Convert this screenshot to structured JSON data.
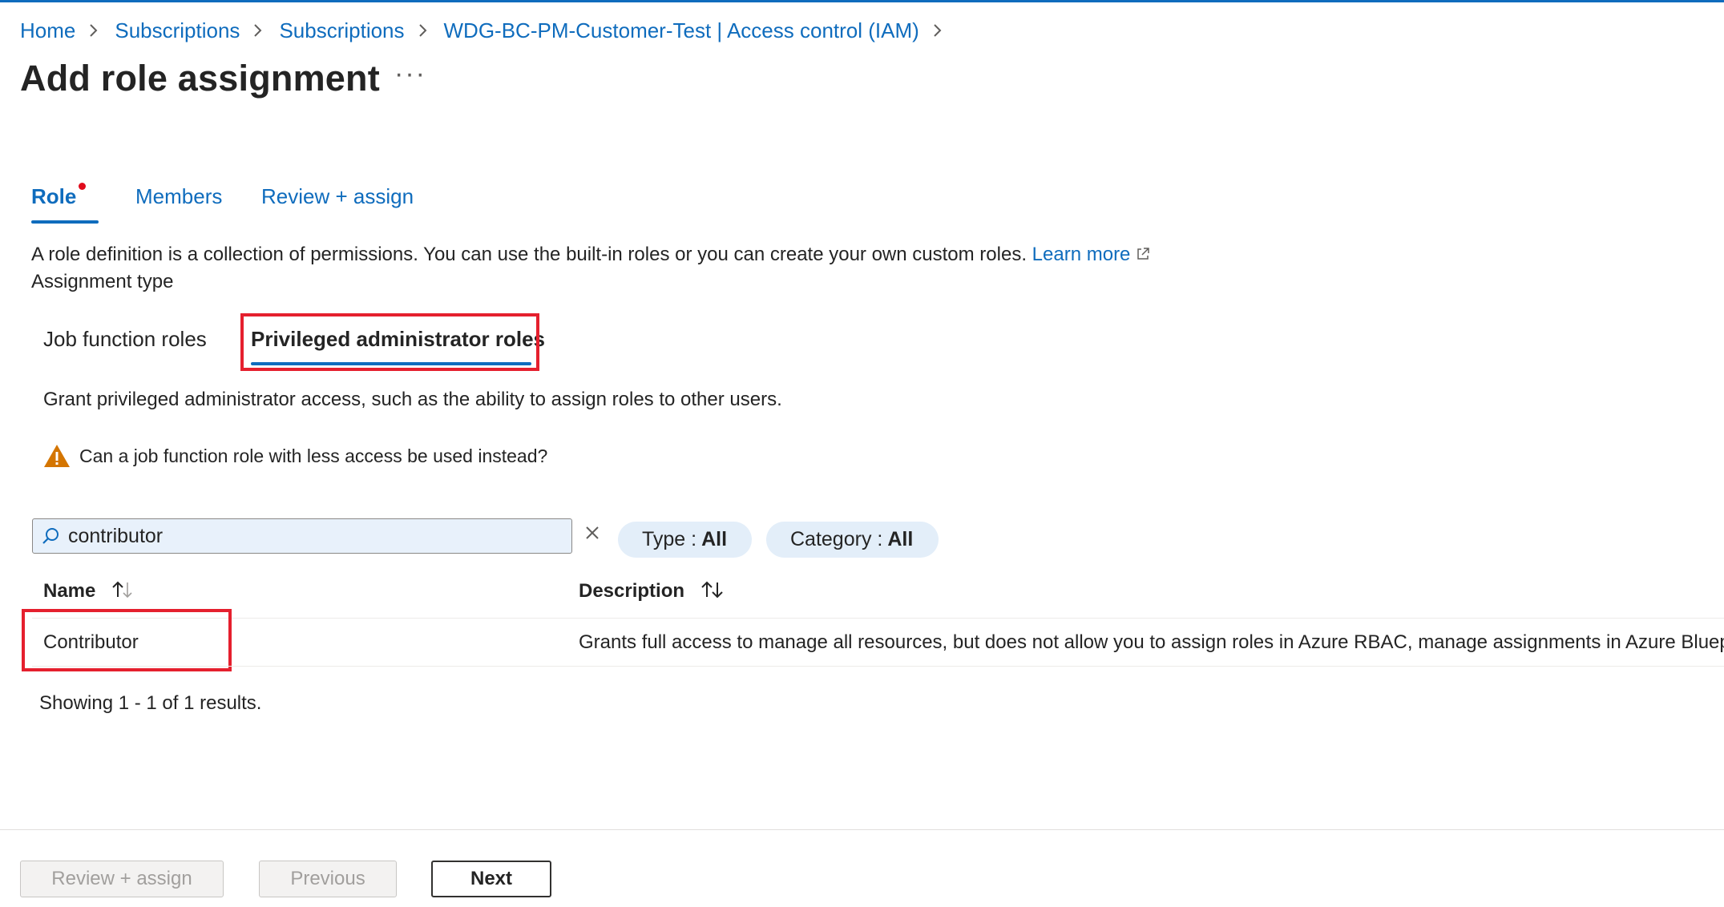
{
  "breadcrumb": {
    "items": [
      "Home",
      "Subscriptions",
      "Subscriptions",
      "WDG-BC-PM-Customer-Test | Access control (IAM)"
    ]
  },
  "page": {
    "title": "Add role assignment",
    "more_label": "···"
  },
  "tabs": [
    {
      "label": "Role"
    },
    {
      "label": "Members"
    },
    {
      "label": "Review + assign"
    }
  ],
  "role_tab": {
    "description": "A role definition is a collection of permissions. You can use the built-in roles or you can create your own custom roles.",
    "learn_more": "Learn more",
    "assignment_type_label": "Assignment type",
    "subtabs": [
      {
        "label": "Job function roles"
      },
      {
        "label": "Privileged administrator roles"
      }
    ],
    "grant_text": "Grant privileged administrator access, such as the ability to assign roles to other users.",
    "warning_text": "Can a job function role with less access be used instead?"
  },
  "search": {
    "value": "contributor"
  },
  "filters": [
    {
      "label": "Type :",
      "value": "All"
    },
    {
      "label": "Category :",
      "value": "All"
    }
  ],
  "table": {
    "columns": [
      "Name",
      "Description"
    ],
    "rows": [
      {
        "name": "Contributor",
        "description": "Grants full access to manage all resources, but does not allow you to assign roles in Azure RBAC, manage assignments in Azure Bluep"
      }
    ],
    "results_text": "Showing 1 - 1 of 1 results."
  },
  "footer": {
    "review_assign": "Review + assign",
    "previous": "Previous",
    "next": "Next"
  },
  "colors": {
    "accent": "#0f6cbd",
    "highlight_box": "#e5202e",
    "warning": "#d47500",
    "required_dot": "#e00b1c"
  }
}
